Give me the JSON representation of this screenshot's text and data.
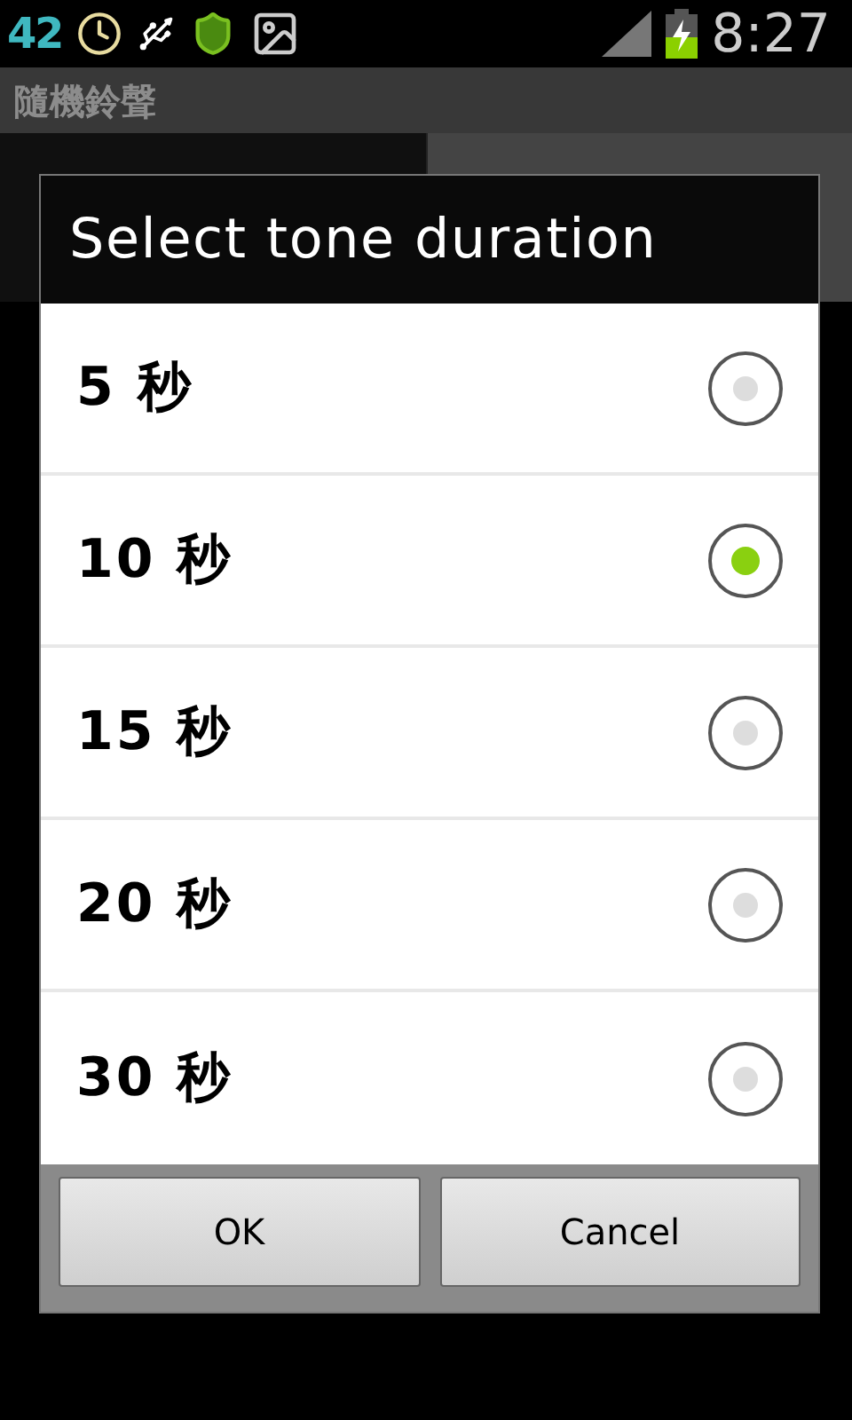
{
  "status_bar": {
    "notification_count": "42",
    "time": "8:27"
  },
  "app": {
    "title": "隨機鈴聲"
  },
  "tabs": [
    {
      "selected": false
    },
    {
      "selected": true
    }
  ],
  "dialog": {
    "title": "Select tone duration",
    "options": [
      {
        "label": "5 秒",
        "selected": false
      },
      {
        "label": "10 秒",
        "selected": true
      },
      {
        "label": "15 秒",
        "selected": false
      },
      {
        "label": "20 秒",
        "selected": false
      },
      {
        "label": "30 秒",
        "selected": false
      }
    ],
    "buttons": [
      "OK",
      "Cancel"
    ]
  }
}
